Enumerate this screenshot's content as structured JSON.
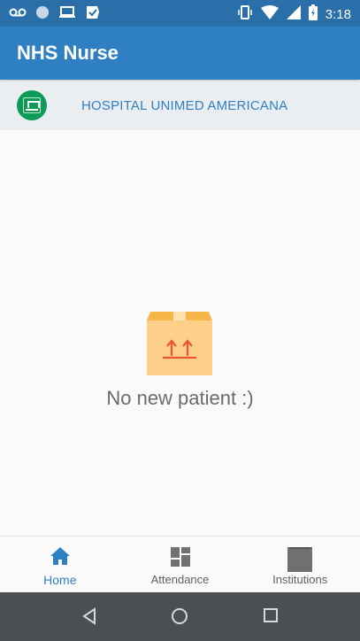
{
  "status_bar": {
    "time": "3:18",
    "left_icons": [
      "voicemail-icon",
      "circle-icon",
      "laptop-icon",
      "tasks-icon"
    ],
    "right_icons": [
      "vibrate-icon",
      "wifi-icon",
      "signal-icon",
      "battery-icon"
    ]
  },
  "app_bar": {
    "title": "NHS Nurse"
  },
  "hospital": {
    "name": "HOSPITAL UNIMED AMERICANA",
    "logo_icon": "unimed-logo"
  },
  "empty_state": {
    "message": "No new patient :)",
    "icon": "box-icon"
  },
  "bottom_nav": {
    "items": [
      {
        "label": "Home",
        "icon": "home-icon",
        "active": true
      },
      {
        "label": "Attendance",
        "icon": "dashboard-icon",
        "active": false
      },
      {
        "label": "Institutions",
        "icon": "building-icon",
        "active": false
      }
    ]
  },
  "system_nav": {
    "buttons": [
      "back-icon",
      "home-circle-icon",
      "recents-icon"
    ]
  },
  "colors": {
    "primary": "#2f80c2",
    "status_bar": "#2a6faa",
    "hospital_bar": "#ebeef0",
    "logo_green": "#0e9b57"
  }
}
